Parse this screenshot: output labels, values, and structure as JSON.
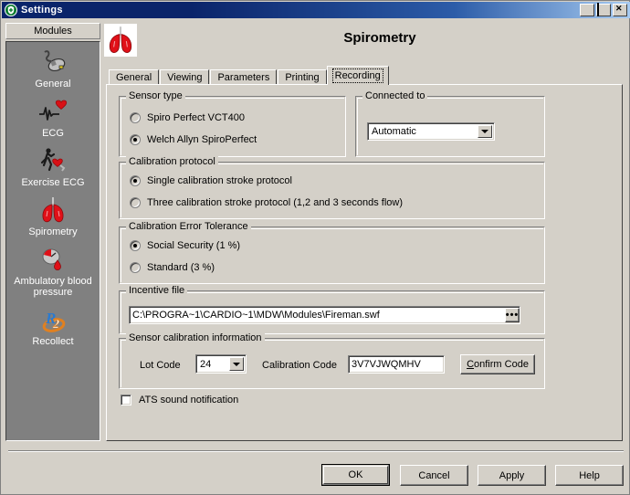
{
  "window": {
    "title": "Settings",
    "icon": "shield-icon",
    "controls": {
      "minimize": "minimize-icon",
      "maximize": "maximize-icon",
      "close": "close-icon"
    }
  },
  "sidebar": {
    "header": "Modules",
    "items": [
      {
        "label": "General",
        "icon": "mouse-icon"
      },
      {
        "label": "ECG",
        "icon": "ecg-heart-icon"
      },
      {
        "label": "Exercise ECG",
        "icon": "runner-heart-icon"
      },
      {
        "label": "Spirometry",
        "icon": "lungs-icon"
      },
      {
        "label": "Ambulatory blood pressure",
        "icon": "bp-cuff-drop-icon"
      },
      {
        "label": "Recollect",
        "icon": "r2-recollect-icon"
      }
    ],
    "selected": "Spirometry"
  },
  "header": {
    "icon": "lungs-icon",
    "title": "Spirometry"
  },
  "tabs": [
    {
      "label": "General",
      "active": false
    },
    {
      "label": "Viewing",
      "active": false
    },
    {
      "label": "Parameters",
      "active": false
    },
    {
      "label": "Printing",
      "active": false
    },
    {
      "label": "Recording",
      "active": true
    }
  ],
  "sensor_type": {
    "legend": "Sensor type",
    "options": [
      {
        "label": "Spiro Perfect VCT400",
        "checked": false
      },
      {
        "label": "Welch Allyn SpiroPerfect",
        "checked": true
      }
    ]
  },
  "connected_to": {
    "legend": "Connected to",
    "value": "Automatic",
    "options": [
      "Automatic"
    ]
  },
  "calibration_protocol": {
    "legend": "Calibration protocol",
    "options": [
      {
        "label": "Single calibration stroke protocol",
        "checked": true
      },
      {
        "label": "Three calibration stroke protocol (1,2 and 3 seconds flow)",
        "checked": false
      }
    ]
  },
  "calibration_error_tolerance": {
    "legend": "Calibration Error Tolerance",
    "options": [
      {
        "label": "Social Security (1 %)",
        "checked": true
      },
      {
        "label": "Standard (3 %)",
        "checked": false
      }
    ]
  },
  "incentive_file": {
    "legend": "Incentive file",
    "value": "C:\\PROGRA~1\\CARDIO~1\\MDW\\Modules\\Fireman.swf",
    "browse_label": "•••"
  },
  "sensor_calibration_information": {
    "legend": "Sensor calibration information",
    "lot_code_label": "Lot Code",
    "lot_code_value": "24",
    "lot_code_options": [
      "24"
    ],
    "calibration_code_label": "Calibration Code",
    "calibration_code_value": "3V7VJWQMHV",
    "confirm_button": {
      "accel": "C",
      "rest": "onfirm Code"
    }
  },
  "ats_checkbox": {
    "label": "ATS sound notification",
    "checked": false
  },
  "footer": {
    "ok": "OK",
    "cancel": "Cancel",
    "apply": "Apply",
    "help": "Help"
  },
  "colors": {
    "face": "#d4d0c8",
    "titlebar": "#0a246a",
    "sidebar_bg": "#808080",
    "accent_red": "#d81016"
  }
}
